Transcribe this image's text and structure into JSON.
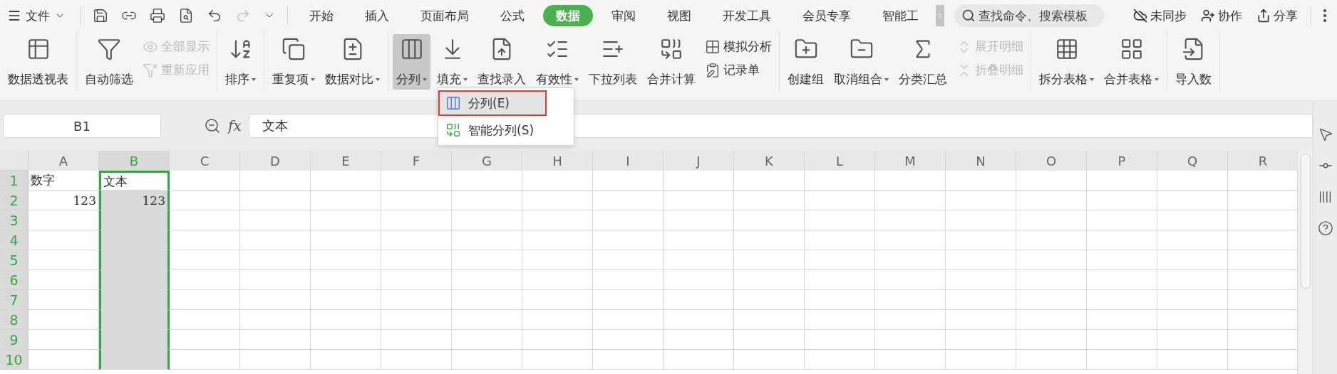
{
  "top_bar": {
    "file_menu": "文件",
    "tabs": [
      {
        "label": "开始",
        "selected": false
      },
      {
        "label": "插入",
        "selected": false
      },
      {
        "label": "页面布局",
        "selected": false
      },
      {
        "label": "公式",
        "selected": false
      },
      {
        "label": "数据",
        "selected": true
      },
      {
        "label": "审阅",
        "selected": false
      },
      {
        "label": "视图",
        "selected": false
      },
      {
        "label": "开发工具",
        "selected": false
      },
      {
        "label": "会员专享",
        "selected": false
      },
      {
        "label": "智能工",
        "selected": false
      }
    ],
    "search": {
      "placeholder": "查找命令、搜索模板"
    },
    "actions": [
      "未同步",
      "协作",
      "分享"
    ]
  },
  "ribbon": {
    "groups": [
      {
        "items": [
          {
            "kind": "large",
            "label": "数据透视表",
            "dropdown": false,
            "active": false
          }
        ]
      },
      {
        "items": [
          {
            "kind": "large",
            "label": "自动筛选",
            "dropdown": false,
            "active": false
          },
          {
            "kind": "stack",
            "items": [
              {
                "label": "全部显示",
                "disabled": true
              },
              {
                "label": "重新应用",
                "disabled": true
              }
            ]
          }
        ]
      },
      {
        "items": [
          {
            "kind": "large",
            "label": "排序",
            "dropdown": true,
            "active": false
          }
        ]
      },
      {
        "items": [
          {
            "kind": "large",
            "label": "重复项",
            "dropdown": true,
            "active": false
          },
          {
            "kind": "large",
            "label": "数据对比",
            "dropdown": true,
            "active": false
          }
        ]
      },
      {
        "items": [
          {
            "kind": "large",
            "label": "分列",
            "dropdown": true,
            "active": true
          },
          {
            "kind": "large",
            "label": "填充",
            "dropdown": true,
            "active": false
          },
          {
            "kind": "large",
            "label": "查找录入",
            "dropdown": false,
            "active": false
          },
          {
            "kind": "large",
            "label": "有效性",
            "dropdown": true,
            "active": false
          },
          {
            "kind": "large",
            "label": "下拉列表",
            "dropdown": false,
            "active": false
          },
          {
            "kind": "large",
            "label": "合并计算",
            "dropdown": false,
            "active": false
          },
          {
            "kind": "stack",
            "items": [
              {
                "label": "模拟分析",
                "disabled": false
              },
              {
                "label": "记录单",
                "disabled": false
              }
            ]
          }
        ]
      },
      {
        "items": [
          {
            "kind": "large",
            "label": "创建组",
            "dropdown": false,
            "active": false
          },
          {
            "kind": "large",
            "label": "取消组合",
            "dropdown": true,
            "active": false
          },
          {
            "kind": "large",
            "label": "分类汇总",
            "dropdown": false,
            "active": false
          },
          {
            "kind": "stack",
            "items": [
              {
                "label": "展开明细",
                "disabled": true
              },
              {
                "label": "折叠明细",
                "disabled": true
              }
            ]
          }
        ]
      },
      {
        "items": [
          {
            "kind": "large",
            "label": "拆分表格",
            "dropdown": true,
            "active": false
          },
          {
            "kind": "large",
            "label": "合并表格",
            "dropdown": true,
            "active": false
          }
        ]
      },
      {
        "items": [
          {
            "kind": "large",
            "label": "导入数",
            "dropdown": false,
            "active": false
          }
        ]
      }
    ]
  },
  "dropdown_menu": {
    "items": [
      {
        "label": "分列(E)",
        "selected": true
      },
      {
        "label": "智能分列(S)",
        "selected": false
      }
    ]
  },
  "formula_bar": {
    "name_box": "B1",
    "fx": "fx",
    "value": "文本"
  },
  "sheet": {
    "columns": [
      {
        "label": "A",
        "selected": false
      },
      {
        "label": "B",
        "selected": true
      },
      {
        "label": "C",
        "selected": false
      },
      {
        "label": "D",
        "selected": false
      },
      {
        "label": "E",
        "selected": false
      },
      {
        "label": "F",
        "selected": false
      },
      {
        "label": "G",
        "selected": false
      },
      {
        "label": "H",
        "selected": false
      },
      {
        "label": "I",
        "selected": false
      },
      {
        "label": "J",
        "selected": false
      },
      {
        "label": "K",
        "selected": false
      },
      {
        "label": "L",
        "selected": false
      },
      {
        "label": "M",
        "selected": false
      },
      {
        "label": "N",
        "selected": false
      },
      {
        "label": "O",
        "selected": false
      },
      {
        "label": "P",
        "selected": false
      },
      {
        "label": "Q",
        "selected": false
      },
      {
        "label": "R",
        "selected": false
      }
    ],
    "rows": [
      {
        "label": "1",
        "cells": [
          {
            "text": "数字",
            "kind": "text",
            "active": false
          },
          {
            "text": "文本",
            "kind": "text",
            "active": true
          }
        ]
      },
      {
        "label": "2",
        "cells": [
          {
            "text": "123",
            "kind": "number",
            "active": false
          },
          {
            "text": "123",
            "kind": "number",
            "active": false
          }
        ]
      },
      {
        "label": "3"
      },
      {
        "label": "4"
      },
      {
        "label": "5"
      },
      {
        "label": "6"
      },
      {
        "label": "7"
      },
      {
        "label": "8"
      },
      {
        "label": "9"
      },
      {
        "label": "10"
      }
    ]
  }
}
